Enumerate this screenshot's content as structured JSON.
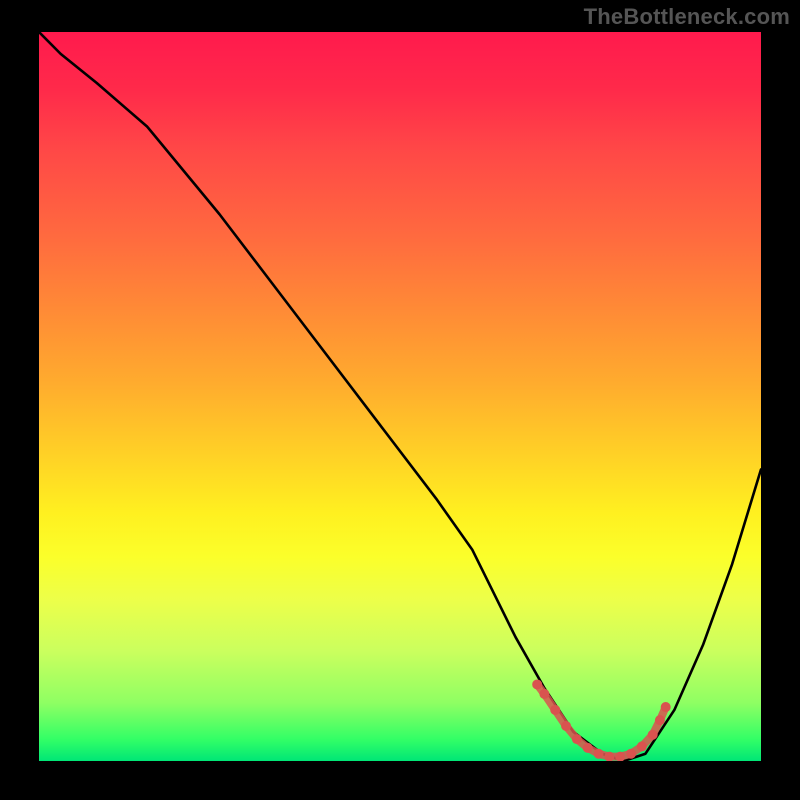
{
  "watermark": "TheBottleneck.com",
  "chart_data": {
    "type": "line",
    "title": "",
    "xlabel": "",
    "ylabel": "",
    "xlim": [
      0,
      100
    ],
    "ylim": [
      0,
      100
    ],
    "grid": false,
    "legend": false,
    "series": [
      {
        "name": "bottleneck-curve",
        "color": "#000000",
        "x": [
          0,
          3,
          8,
          15,
          25,
          35,
          45,
          55,
          60,
          63,
          66,
          70,
          74,
          78,
          81,
          84,
          88,
          92,
          96,
          100
        ],
        "y": [
          100,
          97,
          93,
          87,
          75,
          62,
          49,
          36,
          29,
          23,
          17,
          10,
          4,
          1,
          0,
          1,
          7,
          16,
          27,
          40
        ]
      },
      {
        "name": "optimal-range-marker",
        "color": "#d9534f",
        "type": "scatter",
        "x": [
          69,
          70,
          71.5,
          73,
          74.5,
          76,
          77.5,
          79,
          80.5,
          82,
          83.5,
          85,
          86,
          86.8
        ],
        "y": [
          10.5,
          9.2,
          7.0,
          4.8,
          3.0,
          1.8,
          1.0,
          0.6,
          0.6,
          1.0,
          2.0,
          3.6,
          5.6,
          7.4
        ]
      }
    ],
    "background_gradient_stops": [
      {
        "pos": 0.0,
        "color": "#ff1a4d"
      },
      {
        "pos": 0.28,
        "color": "#ff6a3f"
      },
      {
        "pos": 0.58,
        "color": "#ffd126"
      },
      {
        "pos": 0.78,
        "color": "#ecff4a"
      },
      {
        "pos": 1.0,
        "color": "#00e676"
      }
    ]
  }
}
